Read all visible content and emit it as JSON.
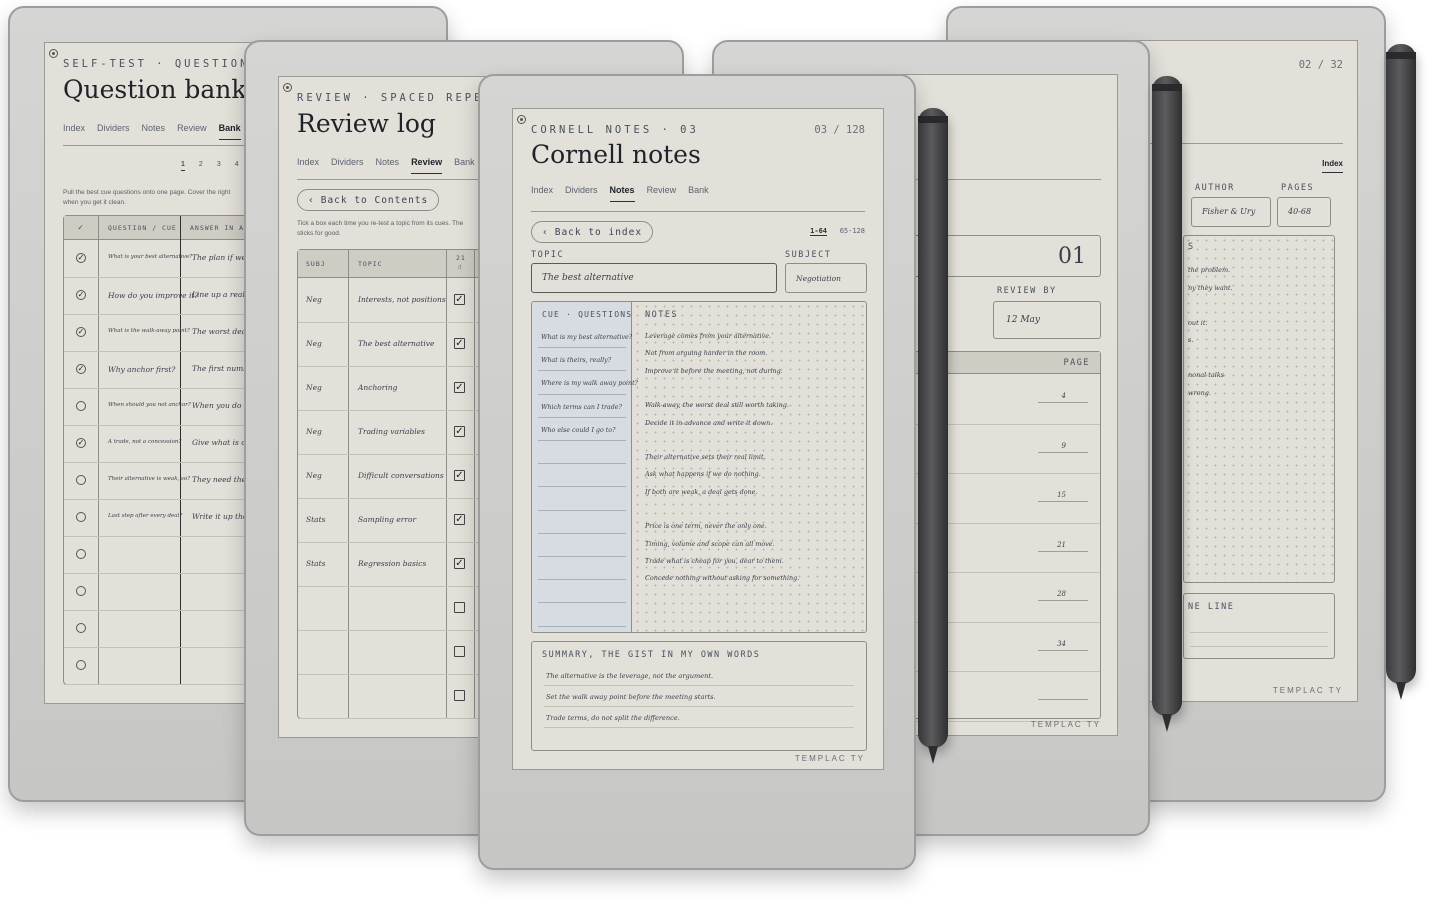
{
  "brand": "TEMPLAC TY",
  "tabs": [
    "Index",
    "Dividers",
    "Notes",
    "Review",
    "Bank"
  ],
  "bank": {
    "kicker": "SELF-TEST · QUESTION BA",
    "title": "Question bank",
    "pages": [
      "1",
      "2",
      "3",
      "4"
    ],
    "intro": "Pull the best cue questions onto one page. Cover the right",
    "intro2": "when you get it clean.",
    "col_check": "✓",
    "col_question": "QUESTION / CUE",
    "col_answer": "ANSWER IN A",
    "rows": [
      {
        "done": true,
        "q": "What is your best alternative?",
        "a": "The plan if we do"
      },
      {
        "done": true,
        "q": "How do you improve it?",
        "a": "Line up a real opti"
      },
      {
        "done": true,
        "q": "What is the walk-away point?",
        "a": "The worst deal sti"
      },
      {
        "done": true,
        "q": "Why anchor first?",
        "a": "The first number"
      },
      {
        "done": false,
        "q": "When should you not anchor?",
        "a": "When you do not k"
      },
      {
        "done": true,
        "q": "A trade, not a concession?",
        "a": "Give what is cheap"
      },
      {
        "done": false,
        "q": "Their alternative is weak, so?",
        "a": "They need the dea"
      },
      {
        "done": false,
        "q": "Last step after every deal?",
        "a": "Write it up the sa"
      },
      {
        "done": false,
        "q": "",
        "a": ""
      },
      {
        "done": false,
        "q": "",
        "a": ""
      },
      {
        "done": false,
        "q": "",
        "a": ""
      },
      {
        "done": false,
        "q": "",
        "a": ""
      }
    ]
  },
  "review": {
    "kicker": "REVIEW · SPACED REPETIT",
    "title": "Review log",
    "back": "Back to Contents",
    "intro": "Tick a box each time you re-test a topic from its cues. The",
    "intro2": "sticks for good.",
    "col_subj": "SUBJ",
    "col_topic": "TOPIC",
    "col_day": "21",
    "col_day_sub": "d",
    "rows": [
      {
        "subj": "Neg",
        "topic": "Interests, not positions",
        "done": true
      },
      {
        "subj": "Neg",
        "topic": "The best alternative",
        "done": true
      },
      {
        "subj": "Neg",
        "topic": "Anchoring",
        "done": true
      },
      {
        "subj": "Neg",
        "topic": "Trading variables",
        "done": true
      },
      {
        "subj": "Neg",
        "topic": "Difficult conversations",
        "done": true
      },
      {
        "subj": "Stats",
        "topic": "Sampling error",
        "done": true
      },
      {
        "subj": "Stats",
        "topic": "Regression basics",
        "done": true
      },
      {
        "subj": "",
        "topic": "",
        "done": false
      },
      {
        "subj": "",
        "topic": "",
        "done": false
      },
      {
        "subj": "",
        "topic": "",
        "done": false
      }
    ]
  },
  "cornell": {
    "kicker": "CORNELL NOTES · 03",
    "page": "03 / 128",
    "title": "Cornell notes",
    "back": "Back to index",
    "range_a": "1-64",
    "range_b": "65-128",
    "topic_label": "TOPIC",
    "topic_value": "The best alternative",
    "subject_label": "SUBJECT",
    "subject_value": "Negotiation",
    "cue_label": "CUE · QUESTIONS",
    "notes_label": "NOTES",
    "cues": [
      "What is my best alternative?",
      "What is theirs, really?",
      "Where is my walk away point?",
      "Which terms can I trade?",
      "Who else could I go to?"
    ],
    "notes": [
      "Leverage comes from your alternative.",
      "Not from arguing harder in the room.",
      "Improve it before the meeting, not during.",
      "",
      "Walk-away, the worst deal still worth taking.",
      "Decide it in advance and write it down.",
      "",
      "Their alternative sets their real limit.",
      "Ask what happens if we do nothing.",
      "If both are weak, a deal gets done.",
      "",
      "Price is one term, never the only one.",
      "Timing, volume and scope can all move.",
      "Trade what is cheap for you, dear to them.",
      "Concede nothing without asking for something."
    ],
    "summary_label": "SUMMARY, THE GIST IN MY OWN WORDS",
    "summary": [
      "The alternative is the leverage, not the argument.",
      "Set the walk away point before the meeting starts.",
      "Trade terms, do not split the difference."
    ]
  },
  "index": {
    "number": "01",
    "review_by_label": "REVIEW BY",
    "review_by_value": "12 May",
    "col_page": "PAGE",
    "pages": [
      "4",
      "9",
      "15",
      "21",
      "28",
      "34",
      ""
    ]
  },
  "source": {
    "page": "02 / 32",
    "tag": "Index",
    "author_label": "AUTHOR",
    "author_value": "Fisher & Ury",
    "pages_label": "PAGES",
    "pages_value": "40-68",
    "letter": "S",
    "lines": [
      "the problem.",
      "ny they want.",
      "",
      "out it.",
      "s.",
      "",
      "nonal talks",
      "wrong."
    ],
    "one_line_label": "NE LINE"
  }
}
